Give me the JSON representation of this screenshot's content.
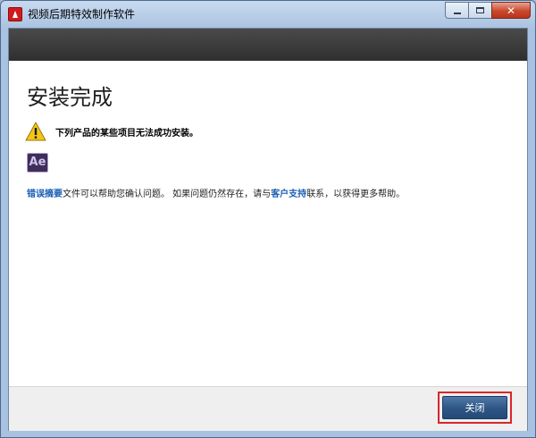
{
  "window": {
    "title": "视频后期特效制作软件"
  },
  "main": {
    "heading": "安装完成",
    "warning_text": "下列产品的某些项目无法成功安装。",
    "product_icon_text": "Ae",
    "info": {
      "link1": "错误摘要",
      "text1": "文件可以帮助您确认问题。 如果问题仍然存在，请与",
      "link2": "客户支持",
      "text2": "联系，以获得更多帮助。"
    }
  },
  "footer": {
    "close_label": "关闭"
  },
  "colors": {
    "accent": "#1a5fb4",
    "highlight": "#d8262c",
    "button": "#2e5584"
  },
  "icons": {
    "app": "adobe-icon",
    "warning": "warning-icon",
    "product": "after-effects-icon"
  }
}
